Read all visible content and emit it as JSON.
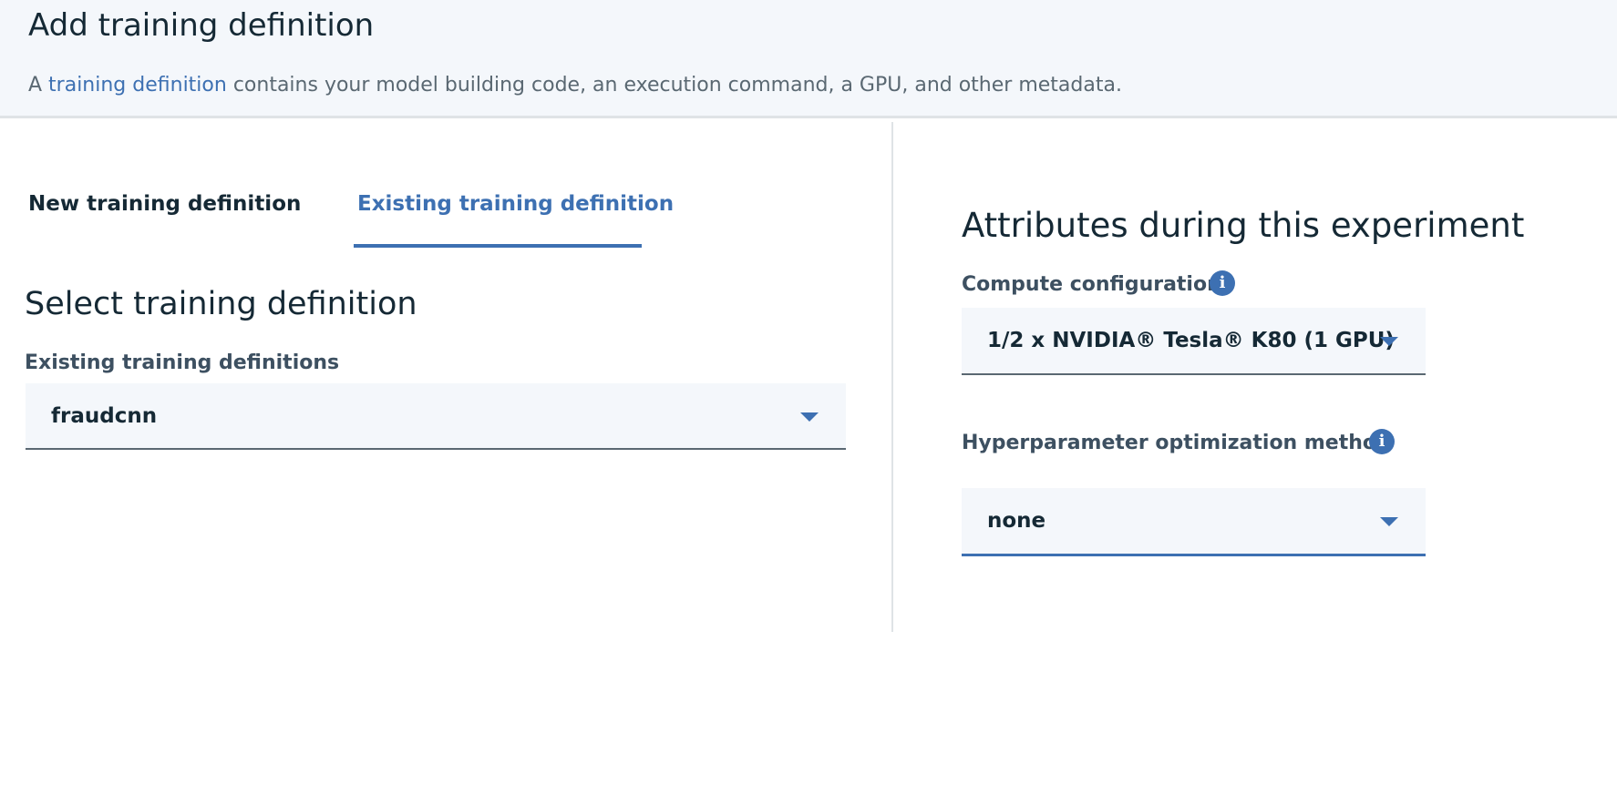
{
  "header": {
    "title": "Add training definition",
    "desc_prefix": "A ",
    "desc_link": "training definition",
    "desc_suffix": " contains your model building code,  an execution command, a GPU, and other metadata."
  },
  "tabs": [
    {
      "label": "New training definition",
      "active": false
    },
    {
      "label": "Existing training definition",
      "active": true
    }
  ],
  "left": {
    "section_title": "Select training definition",
    "field_label": "Existing training definitions",
    "selected_value": "fraudcnn"
  },
  "right": {
    "title": "Attributes during this experiment",
    "compute": {
      "label": "Compute configuration",
      "value": "1/2 x NVIDIA® Tesla® K80 (1 GPU)"
    },
    "hpo": {
      "label": "Hyperparameter optimization method",
      "value": "none"
    }
  },
  "icons": {
    "info": "info-icon",
    "dropdown": "chevron-down-icon"
  },
  "colors": {
    "accent": "#3d70b2",
    "header_bg": "#f4f7fb",
    "text": "#152935"
  }
}
